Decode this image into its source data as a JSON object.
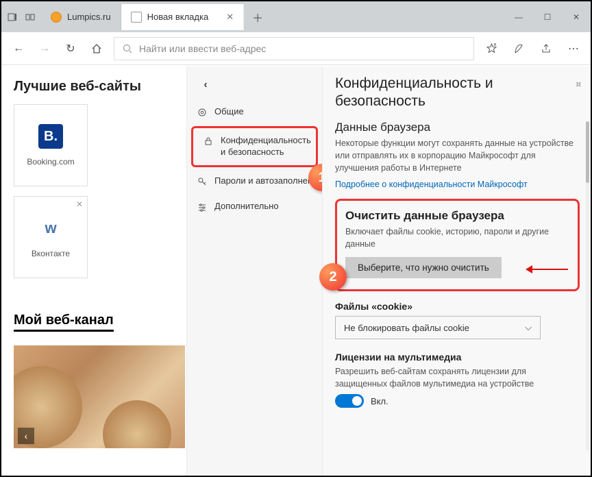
{
  "titlebar": {
    "tabs": [
      {
        "label": "Lumpics.ru"
      },
      {
        "label": "Новая вкладка"
      }
    ]
  },
  "addr": {
    "placeholder": "Найти или ввести веб-адрес"
  },
  "left": {
    "heading": "Лучшие веб-сайты",
    "tiles": [
      {
        "label": "Booking.com",
        "logo": "B."
      },
      {
        "label": "Вконтакте",
        "logo": "w"
      }
    ],
    "feed_heading": "Мой веб-канал"
  },
  "mid": {
    "items": [
      {
        "icon": "gear",
        "label": "Общие"
      },
      {
        "icon": "lock",
        "label": "Конфиденциальность и безопасность",
        "highlight": true
      },
      {
        "icon": "key",
        "label": "Пароли и автозаполнен"
      },
      {
        "icon": "sliders",
        "label": "Дополнительно"
      }
    ]
  },
  "right": {
    "title": "Конфиденциальность и безопасность",
    "data_heading": "Данные браузера",
    "data_desc": "Некоторые функции могут сохранять данные на устройстве или отправлять их в корпорацию Майкрософт для улучшения работы в Интернете",
    "data_link": "Подробнее о конфиденциальности Майкрософт",
    "clear_heading": "Очистить данные браузера",
    "clear_desc": "Включает файлы cookie, историю, пароли и другие данные",
    "clear_button": "Выберите, что нужно очистить",
    "cookie_heading": "Файлы «cookie»",
    "cookie_value": "Не блокировать файлы cookie",
    "media_heading": "Лицензии на мультимедиа",
    "media_desc": "Разрешить веб-сайтам сохранять лицензии для защищенных файлов мультимедиа на устройстве",
    "toggle_label": "Вкл."
  },
  "annotations": {
    "b1": "1",
    "b2": "2"
  }
}
